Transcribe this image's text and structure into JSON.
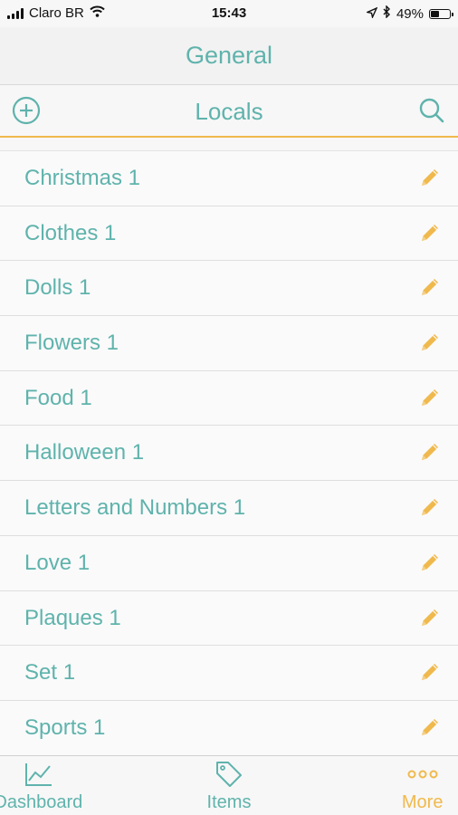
{
  "status_bar": {
    "carrier": "Claro BR",
    "time": "15:43",
    "battery_percent_label": "49%",
    "battery_level": 0.49
  },
  "header": {
    "title": "General",
    "section_title": "Locals"
  },
  "list": {
    "items": [
      {
        "label": "Christmas 1"
      },
      {
        "label": "Clothes 1"
      },
      {
        "label": "Dolls 1"
      },
      {
        "label": "Flowers 1"
      },
      {
        "label": "Food 1"
      },
      {
        "label": "Halloween 1"
      },
      {
        "label": "Letters and Numbers 1"
      },
      {
        "label": "Love 1"
      },
      {
        "label": "Plaques 1"
      },
      {
        "label": "Set 1"
      },
      {
        "label": "Sports 1"
      }
    ]
  },
  "tabbar": {
    "tabs": [
      {
        "label": "Dashboard",
        "icon": "chart-line-icon",
        "active": false
      },
      {
        "label": "Items",
        "icon": "tag-icon",
        "active": false
      },
      {
        "label": "More",
        "icon": "more-dots-icon",
        "active": true
      }
    ]
  },
  "colors": {
    "accent_teal": "#5fb3ac",
    "accent_orange": "#f0b94d",
    "background": "#f7f7f7"
  }
}
